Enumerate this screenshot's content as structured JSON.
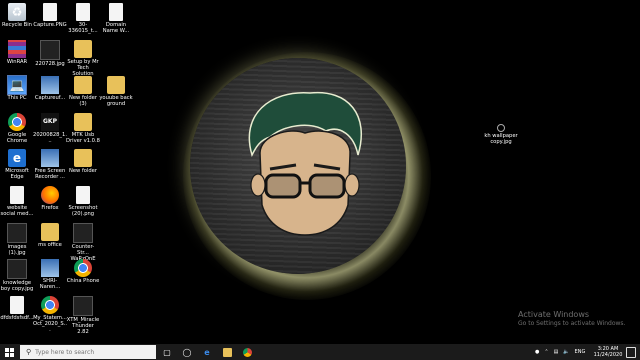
{
  "desktop_icons": [
    {
      "name": "recycle-bin-icon",
      "label": "Recycle Bin",
      "kind": "bin",
      "glyph": "♻"
    },
    {
      "name": "capture-png-icon",
      "label": "Capture.PNG",
      "kind": "file",
      "glyph": ""
    },
    {
      "name": "file-30-336015-icon",
      "label": "30-336015_t...",
      "kind": "file",
      "glyph": ""
    },
    {
      "name": "domain-name-file-icon",
      "label": "Domain Name W...",
      "kind": "file",
      "glyph": ""
    },
    {
      "name": "winrar-icon",
      "label": "WinRAR",
      "kind": "winrar",
      "glyph": ""
    },
    {
      "name": "image-220728-icon",
      "label": "220728.jpg",
      "kind": "dark",
      "glyph": ""
    },
    {
      "name": "setup-mr-tech-icon",
      "label": "Setup by Mr Tech Solution",
      "kind": "folder",
      "glyph": ""
    },
    {
      "name": "this-pc-icon",
      "label": "This PC",
      "kind": "pc",
      "glyph": "💻"
    },
    {
      "name": "captureu-icon",
      "label": "Captureuf...",
      "kind": "img",
      "glyph": ""
    },
    {
      "name": "new-folder-3-icon",
      "label": "New folder (3)",
      "kind": "folder",
      "glyph": ""
    },
    {
      "name": "youube-back-ground-icon",
      "label": "youube back ground",
      "kind": "folder",
      "glyph": ""
    },
    {
      "name": "google-chrome-icon",
      "label": "Google Chrome",
      "kind": "chrome",
      "glyph": ""
    },
    {
      "name": "image-20200828-icon",
      "label": "20200828_1...",
      "kind": "gkp",
      "glyph": "GKP"
    },
    {
      "name": "mtk-usb-driver-icon",
      "label": "MTK Usb Driver v1.0.8",
      "kind": "folder",
      "glyph": ""
    },
    {
      "name": "microsoft-edge-icon",
      "label": "Microsoft Edge",
      "kind": "edge",
      "glyph": "e"
    },
    {
      "name": "free-screen-recorder-icon",
      "label": "Free Screen Recorder ...",
      "kind": "img",
      "glyph": ""
    },
    {
      "name": "new-folder-icon",
      "label": "New folder",
      "kind": "folder",
      "glyph": ""
    },
    {
      "name": "website-social-media-icon",
      "label": "website social med...",
      "kind": "file",
      "glyph": ""
    },
    {
      "name": "firefox-icon",
      "label": "Firefox",
      "kind": "firefox",
      "glyph": ""
    },
    {
      "name": "screenshot-20-icon",
      "label": "Screenshot (20).png",
      "kind": "file",
      "glyph": ""
    },
    {
      "name": "images-1-icon",
      "label": "images (1).jpg",
      "kind": "dark",
      "glyph": ""
    },
    {
      "name": "ms-office-icon",
      "label": "ms office",
      "kind": "folder",
      "glyph": ""
    },
    {
      "name": "counter-strike-icon",
      "label": "Counter-Str... WaRzOnE",
      "kind": "dark",
      "glyph": ""
    },
    {
      "name": "knowledge-boy-icon",
      "label": "knowledge boy copy.jpg",
      "kind": "dark",
      "glyph": ""
    },
    {
      "name": "shri-narendra-icon",
      "label": "SHRI-Naren...",
      "kind": "img",
      "glyph": ""
    },
    {
      "name": "china-phone-icon",
      "label": "China Phone",
      "kind": "chrome",
      "glyph": ""
    },
    {
      "name": "dfdsfdsfsdf-icon",
      "label": "dfdsfdsfsdf...",
      "kind": "file",
      "glyph": ""
    },
    {
      "name": "my-statement-icon",
      "label": "My_Statem... Oct_2020_S...",
      "kind": "chrome",
      "glyph": ""
    },
    {
      "name": "xtm-miracle-thunder-icon",
      "label": "XTM_Miracle Thunder 2.82",
      "kind": "dark",
      "glyph": ""
    },
    {
      "name": "kh-wallpaper-icon",
      "label": "kh wallpaper copy.jpg",
      "kind": "small",
      "glyph": ""
    }
  ],
  "watermark": {
    "title": "Activate Windows",
    "subtitle": "Go to Settings to activate Windows."
  },
  "taskbar": {
    "search_placeholder": "Type here to search",
    "apps": [
      {
        "name": "task-view-icon",
        "glyph": "▢"
      },
      {
        "name": "cortana-icon",
        "glyph": "◯"
      },
      {
        "name": "edge-taskbar-icon",
        "glyph": "e"
      },
      {
        "name": "file-explorer-taskbar-icon",
        "glyph": ""
      },
      {
        "name": "chrome-taskbar-icon",
        "glyph": ""
      }
    ],
    "tray": {
      "lang": "ENG",
      "time": "3:20 AM",
      "date": "11/24/2020"
    }
  }
}
